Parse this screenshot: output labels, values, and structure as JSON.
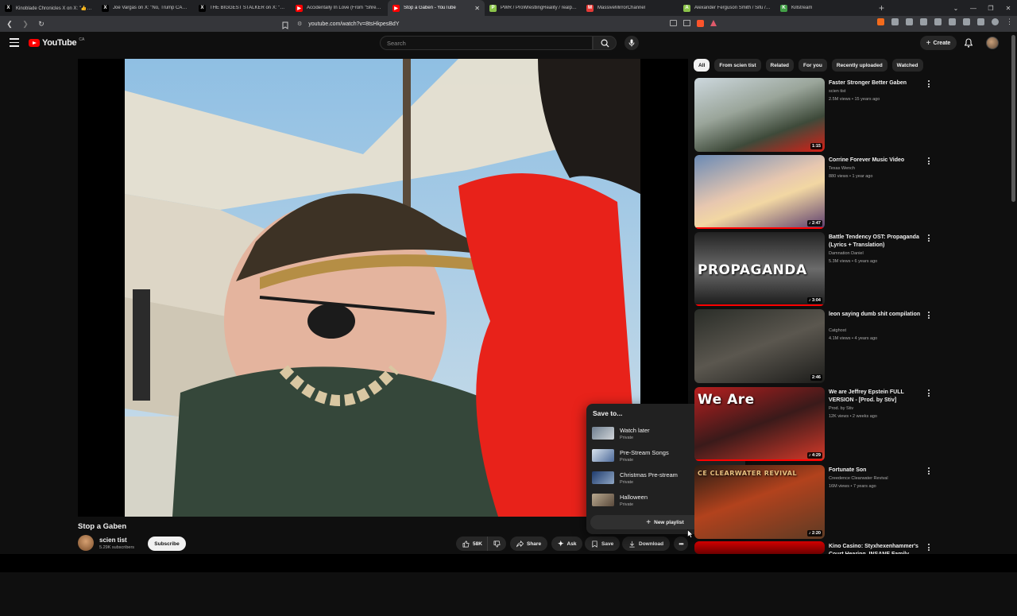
{
  "browser": {
    "tabs": [
      {
        "title": "Kinoblade Chronicles X on X: \"👍Stay",
        "fav": "X",
        "favcolor": "#000000"
      },
      {
        "title": "Joe Vargas on X: \"No, Trump CANN",
        "fav": "X",
        "favcolor": "#000000"
      },
      {
        "title": "THE BIGGEST STALKER on X: \"COG H",
        "fav": "X",
        "favcolor": "#000000"
      },
      {
        "title": "Accidentally In Love (From \"Shrek 2\"",
        "fav": "▶",
        "favcolor": "#ff0000"
      },
      {
        "title": "Stop a Gaben - YouTube",
        "fav": "▶",
        "favcolor": "#ff0000",
        "active": true
      },
      {
        "title": "PWR / ProWrestlingReality / realpem",
        "fav": "P",
        "favcolor": "#8bc34a"
      },
      {
        "title": "MassiveMirrorChannel",
        "fav": "M",
        "favcolor": "#e53935"
      },
      {
        "title": "Alexander Ferguson Smith / Sifu / Sh",
        "fav": "A",
        "favcolor": "#8bc34a"
      },
      {
        "title": "Killstream",
        "fav": "K",
        "favcolor": "#43a047"
      }
    ],
    "url": "youtube.com/watch?v=8tsHkpesBdY"
  },
  "header": {
    "logo_text": "YouTube",
    "country": "CA",
    "search_placeholder": "Search",
    "create_label": "Create"
  },
  "video": {
    "title": "Stop a Gaben",
    "channel": "scien tist",
    "subscribers": "5.29K subscribers",
    "subscribe_label": "Subscribe",
    "likes": "58K",
    "share_label": "Share",
    "ask_label": "Ask",
    "save_label": "Save",
    "download_label": "Download"
  },
  "save_popup": {
    "heading": "Save to...",
    "playlists": [
      {
        "name": "Watch later",
        "privacy": "Private"
      },
      {
        "name": "Pre-Stream Songs",
        "privacy": "Private"
      },
      {
        "name": "Christmas Pre-stream",
        "privacy": "Private"
      },
      {
        "name": "Halloween",
        "privacy": "Private"
      }
    ],
    "new_playlist_label": "New playlist"
  },
  "chips": [
    "All",
    "From scien tist",
    "Related",
    "For you",
    "Recently uploaded",
    "Watched"
  ],
  "recommendations": [
    {
      "title": "Faster Stronger Better Gaben",
      "channel": "scien tist",
      "meta": "2.5M views • 15 years ago",
      "duration": "1:15"
    },
    {
      "title": "Corrine Forever Music Video",
      "channel": "Texas Wench",
      "meta": "880 views • 1 year ago",
      "duration": "♪ 2:47"
    },
    {
      "title": "Battle Tendency OST: Propaganda (Lyrics + Translation)",
      "channel": "Damnation Daniel",
      "meta": "5.3M views • 6 years ago",
      "duration": "♪ 3:04",
      "thumb_text": "PROPAGANDA"
    },
    {
      "title": "leon saying dumb shit compilation",
      "channel": "Catghost",
      "meta": "4.1M views • 4 years ago",
      "duration": "2:46"
    },
    {
      "title": "We are Jeffrey Epstein FULL VERSION - [Prod. by Stiv]",
      "channel": "Prod. by Stiv",
      "meta": "12K views • 2 weeks ago",
      "duration": "♪ 4:29",
      "thumb_text": "We Are"
    },
    {
      "title": "Fortunate Son",
      "channel": "Creedence Clearwater Revival",
      "meta": "16M views • 7 years ago",
      "duration": "♪ 2:20",
      "thumb_text": "CE CLEARWATER REVIVAL"
    },
    {
      "title": "Kino Casino: Styxhexenhammer's Court Hearing, INSANE Family Lore",
      "channel": "",
      "meta": "",
      "duration": ""
    }
  ]
}
